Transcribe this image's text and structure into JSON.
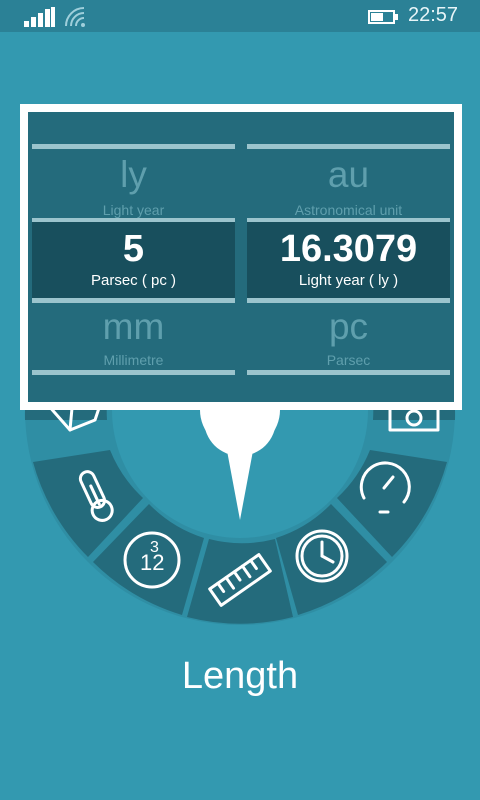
{
  "status_bar": {
    "time": "22:57",
    "icons": [
      "signal-icon",
      "wifi-icon",
      "battery-icon"
    ]
  },
  "converter": {
    "top_row": [
      {
        "abbr": "ly",
        "name": "Light year"
      },
      {
        "abbr": "au",
        "name": "Astronomical unit"
      }
    ],
    "selected": [
      {
        "value": "5",
        "label": "Parsec ( pc )"
      },
      {
        "value": "16.3079",
        "label": "Light year ( ly )"
      }
    ],
    "bottom_row": [
      {
        "abbr": "mm",
        "name": "Millimetre"
      },
      {
        "abbr": "pc",
        "name": "Parsec"
      }
    ]
  },
  "dial": {
    "categories": [
      "volume-icon",
      "temperature-icon",
      "number-base-icon",
      "length-icon",
      "time-icon",
      "speed-icon",
      "weight-icon"
    ],
    "selected": "length-icon"
  },
  "category_title": "Length",
  "colors": {
    "background": "#3399b0",
    "dial_segment": "#246b7c",
    "card_border": "#ffffff"
  }
}
